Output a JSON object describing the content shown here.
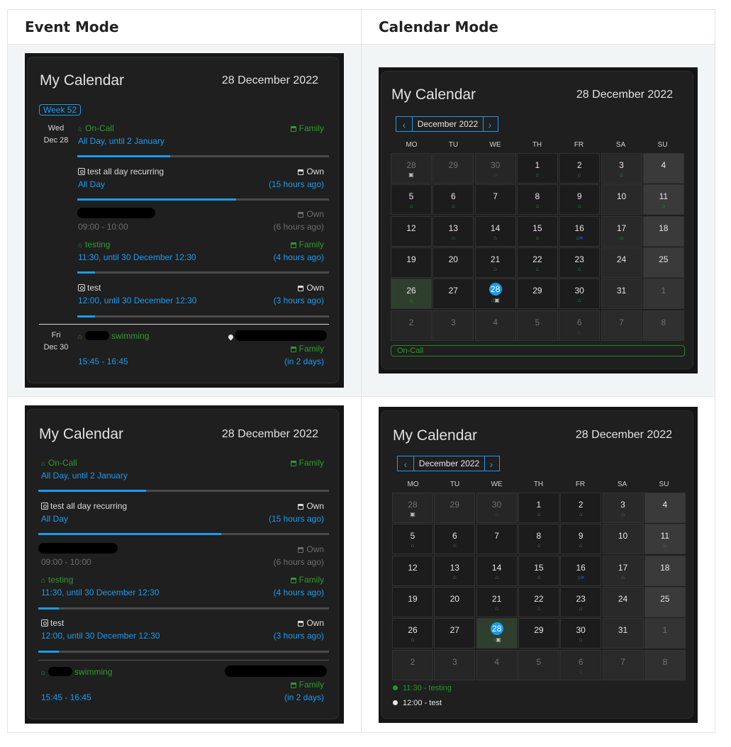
{
  "headers": {
    "event_mode": "Event Mode",
    "calendar_mode": "Calendar Mode"
  },
  "card": {
    "title": "My Calendar",
    "date": "28 December 2022"
  },
  "event_top": {
    "week_badge": "Week 52",
    "day1": {
      "dow": "Wed",
      "date": "Dec 28"
    },
    "day2": {
      "dow": "Fri",
      "date": "Dec 30"
    }
  },
  "events": {
    "oncall": {
      "title": "On-Call",
      "time": "All Day, until 2 January",
      "calendar": "Family",
      "progress": 0.37
    },
    "recurring": {
      "title": "test all day recurring",
      "time": "All Day",
      "calendar": "Own",
      "relative": "(15 hours ago)",
      "progress": 0.63
    },
    "hidden": {
      "time": "09:00 - 10:00",
      "calendar": "Own",
      "relative": "(6 hours ago)"
    },
    "testing": {
      "title": "testing",
      "time": "11:30, until 30 December 12:30",
      "calendar": "Family",
      "relative": "(4 hours ago)",
      "progress": 0.07
    },
    "test": {
      "title": "test",
      "time": "12:00, until 30 December 12:30",
      "calendar": "Own",
      "relative": "(3 hours ago)",
      "progress": 0.07
    },
    "swimming": {
      "title": "swimming",
      "time": "15:45 - 16:45",
      "calendar": "Family",
      "relative": "(in 2 days)"
    }
  },
  "calendar": {
    "month_label": "December 2022",
    "prev": "‹",
    "next": "›",
    "weekdays": [
      "MO",
      "TU",
      "WE",
      "TH",
      "FR",
      "SA",
      "SU"
    ],
    "days": [
      {
        "n": "28",
        "other": true,
        "m": "r"
      },
      {
        "n": "29",
        "other": true,
        "m": ""
      },
      {
        "n": "30",
        "other": true,
        "m": "d"
      },
      {
        "n": "1",
        "m": "g"
      },
      {
        "n": "2",
        "m": "g"
      },
      {
        "n": "3",
        "m": "g"
      },
      {
        "n": "4",
        "m": ""
      },
      {
        "n": "5",
        "m": "g"
      },
      {
        "n": "6",
        "m": "g"
      },
      {
        "n": "7",
        "m": ""
      },
      {
        "n": "8",
        "m": "g"
      },
      {
        "n": "9",
        "m": "g"
      },
      {
        "n": "10",
        "m": ""
      },
      {
        "n": "11",
        "m": "g"
      },
      {
        "n": "12",
        "m": ""
      },
      {
        "n": "13",
        "m": "g"
      },
      {
        "n": "14",
        "m": "g"
      },
      {
        "n": "15",
        "m": "g"
      },
      {
        "n": "16",
        "m": "gb"
      },
      {
        "n": "17",
        "m": "g"
      },
      {
        "n": "18",
        "m": ""
      },
      {
        "n": "19",
        "m": ""
      },
      {
        "n": "20",
        "m": ""
      },
      {
        "n": "21",
        "m": "g"
      },
      {
        "n": "22",
        "m": "g"
      },
      {
        "n": "23",
        "m": "g"
      },
      {
        "n": "24",
        "m": ""
      },
      {
        "n": "25",
        "m": ""
      },
      {
        "n": "26",
        "m": "g"
      },
      {
        "n": "27",
        "m": ""
      },
      {
        "n": "28",
        "m": "gr",
        "today": true
      },
      {
        "n": "29",
        "m": ""
      },
      {
        "n": "30",
        "m": "g"
      },
      {
        "n": "31",
        "m": ""
      },
      {
        "n": "1",
        "other": true,
        "m": ""
      },
      {
        "n": "2",
        "other": true,
        "m": ""
      },
      {
        "n": "3",
        "other": true,
        "m": ""
      },
      {
        "n": "4",
        "other": true,
        "m": ""
      },
      {
        "n": "5",
        "other": true,
        "m": ""
      },
      {
        "n": "6",
        "other": true,
        "m": "d"
      },
      {
        "n": "7",
        "other": true,
        "m": ""
      },
      {
        "n": "8",
        "other": true,
        "m": ""
      }
    ],
    "selected_top": "On-Call",
    "list_bottom": [
      {
        "text": "11:30 - testing",
        "color": "#1f9a1f"
      },
      {
        "text": "12:00 - test",
        "color": "#e6e6e6"
      }
    ]
  },
  "colors": {
    "accent": "#1a9bf0",
    "green": "#2e9b2e",
    "blue_dot": "#1533d6"
  }
}
